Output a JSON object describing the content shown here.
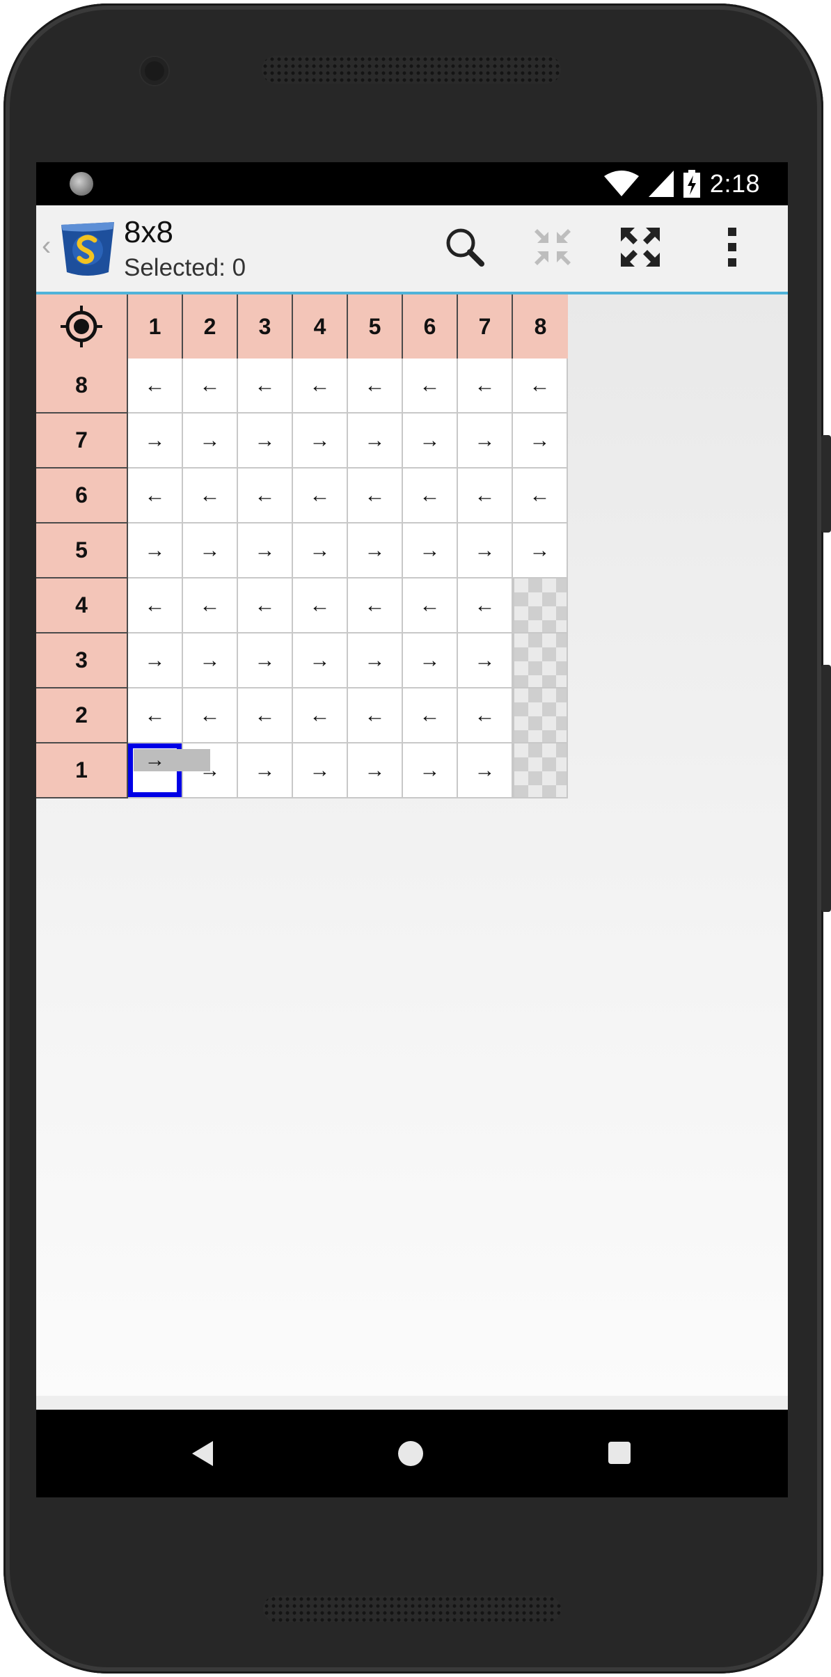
{
  "statusbar": {
    "time": "2:18",
    "icons": [
      "notification-dot-icon",
      "wifi-icon",
      "signal-icon",
      "battery-charging-icon"
    ]
  },
  "appbar": {
    "title": "8x8",
    "subtitle": "Selected: 0",
    "actions": [
      "search-icon",
      "collapse-icon",
      "expand-icon",
      "more-vert-icon"
    ],
    "accent_color": "#4fb3d9"
  },
  "grid": {
    "corner_icon": "crosshair-target-icon",
    "column_headers": [
      "1",
      "2",
      "3",
      "4",
      "5",
      "6",
      "7",
      "8"
    ],
    "row_headers": [
      "8",
      "7",
      "6",
      "5",
      "4",
      "3",
      "2",
      "1"
    ],
    "rows": [
      [
        "←",
        "←",
        "←",
        "←",
        "←",
        "←",
        "←",
        "←"
      ],
      [
        "→",
        "→",
        "→",
        "→",
        "→",
        "→",
        "→",
        "→"
      ],
      [
        "←",
        "←",
        "←",
        "←",
        "←",
        "←",
        "←",
        "←"
      ],
      [
        "→",
        "→",
        "→",
        "→",
        "→",
        "→",
        "→",
        "→"
      ],
      [
        "←",
        "←",
        "←",
        "←",
        "←",
        "←",
        "←",
        ""
      ],
      [
        "→",
        "→",
        "→",
        "→",
        "→",
        "→",
        "→",
        ""
      ],
      [
        "←",
        "←",
        "←",
        "←",
        "←",
        "←",
        "←",
        ""
      ],
      [
        "→",
        "→",
        "→",
        "→",
        "→",
        "→",
        "→",
        ""
      ]
    ],
    "header_color": "#f3c5b8",
    "selected_color": "#0000e6"
  },
  "navbar": {
    "buttons": [
      "back-icon",
      "home-icon",
      "recents-icon"
    ]
  }
}
